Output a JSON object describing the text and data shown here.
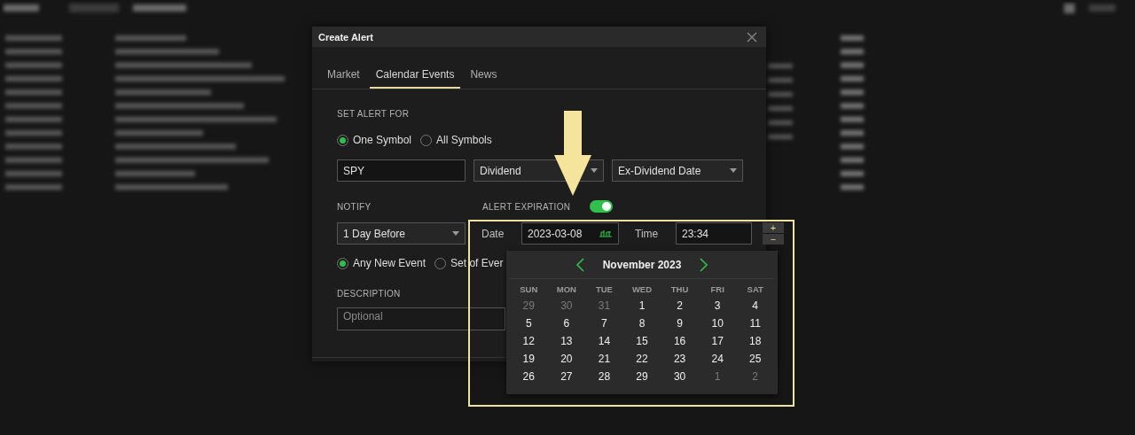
{
  "dialog": {
    "title": "Create Alert",
    "tabs": [
      {
        "label": "Market",
        "selected": false
      },
      {
        "label": "Calendar Events",
        "selected": true
      },
      {
        "label": "News",
        "selected": false
      }
    ],
    "set_alert_for": {
      "label": "SET ALERT FOR",
      "options": [
        {
          "label": "One Symbol",
          "selected": true
        },
        {
          "label": "All Symbols",
          "selected": false
        }
      ]
    },
    "symbol": {
      "value": "SPY"
    },
    "event_type": {
      "value": "Dividend"
    },
    "event_field": {
      "value": "Ex-Dividend Date"
    },
    "notify": {
      "label": "NOTIFY",
      "value": "1 Day Before",
      "options": [
        {
          "label": "Any New Event",
          "selected": true
        },
        {
          "label": "Set of Ever",
          "selected": false
        }
      ]
    },
    "alert_expiration": {
      "label": "ALERT EXPIRATION",
      "on": true,
      "date_label": "Date",
      "date": "2023-03-08",
      "time_label": "Time",
      "time": "23:34",
      "increment": "+",
      "decrement": "−"
    },
    "description": {
      "label": "DESCRIPTION",
      "placeholder": "Optional"
    }
  },
  "calendar": {
    "month": "November 2023",
    "weekdays": [
      "SUN",
      "MON",
      "TUE",
      "WED",
      "THU",
      "FRI",
      "SAT"
    ],
    "days": [
      {
        "label": "29",
        "outside": true
      },
      {
        "label": "30",
        "outside": true
      },
      {
        "label": "31",
        "outside": true
      },
      {
        "label": "1",
        "outside": false
      },
      {
        "label": "2",
        "outside": false
      },
      {
        "label": "3",
        "outside": false
      },
      {
        "label": "4",
        "outside": false
      },
      {
        "label": "5",
        "outside": false
      },
      {
        "label": "6",
        "outside": false
      },
      {
        "label": "7",
        "outside": false
      },
      {
        "label": "8",
        "outside": false
      },
      {
        "label": "9",
        "outside": false
      },
      {
        "label": "10",
        "outside": false
      },
      {
        "label": "11",
        "outside": false
      },
      {
        "label": "12",
        "outside": false
      },
      {
        "label": "13",
        "outside": false
      },
      {
        "label": "14",
        "outside": false
      },
      {
        "label": "15",
        "outside": false
      },
      {
        "label": "16",
        "outside": false
      },
      {
        "label": "17",
        "outside": false
      },
      {
        "label": "18",
        "outside": false
      },
      {
        "label": "19",
        "outside": false
      },
      {
        "label": "20",
        "outside": false
      },
      {
        "label": "21",
        "outside": false
      },
      {
        "label": "22",
        "outside": false
      },
      {
        "label": "23",
        "outside": false
      },
      {
        "label": "24",
        "outside": false
      },
      {
        "label": "25",
        "outside": false
      },
      {
        "label": "26",
        "outside": false
      },
      {
        "label": "27",
        "outside": false
      },
      {
        "label": "28",
        "outside": false
      },
      {
        "label": "29",
        "outside": false
      },
      {
        "label": "30",
        "outside": false
      },
      {
        "label": "1",
        "outside": true
      },
      {
        "label": "2",
        "outside": true
      }
    ]
  }
}
